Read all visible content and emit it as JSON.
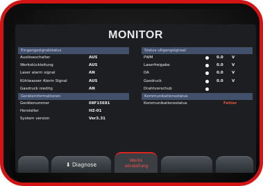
{
  "screen": {
    "title": "MONITOR"
  },
  "left": {
    "input_status": {
      "header": "Eingangssignalstatus",
      "rows": [
        {
          "label": "Auslöseschalter",
          "value": "AUS"
        },
        {
          "label": "Werkstückleitung",
          "value": "AUS"
        },
        {
          "label": "Laser alarm signal",
          "value": "AN"
        },
        {
          "label": "Kühlwasser Alarm Signal",
          "value": "AUS"
        },
        {
          "label": "Gasdruck niedrig",
          "value": "AN"
        }
      ]
    },
    "device_info": {
      "header": "Geräteinformationen",
      "rows": [
        {
          "label": "Gerätenummer",
          "value": "08F15E81"
        },
        {
          "label": "Hersteller",
          "value": "HZ-01"
        },
        {
          "label": "System version",
          "value": "Ver3.31"
        }
      ]
    }
  },
  "right": {
    "output_status": {
      "header": "Status ultgangsignaal",
      "rows": [
        {
          "label": "PWM",
          "value": "0.0",
          "unit": "V"
        },
        {
          "label": "Laserfreigabe",
          "value": "0.0",
          "unit": "V"
        },
        {
          "label": "DA",
          "value": "0.0",
          "unit": "V"
        },
        {
          "label": "Gasdruck",
          "value": "0.0",
          "unit": "V"
        },
        {
          "label": "Drahtvorschub"
        }
      ]
    },
    "comm_status": {
      "header": "Kommunikationsstatus",
      "rows": [
        {
          "label": "Kommunikationsstatus",
          "value": "Fehler"
        }
      ]
    }
  },
  "tabs": [
    {
      "label": ""
    },
    {
      "label": "Diagnose",
      "icon": "down-arrow-icon"
    },
    {
      "label_line1": "Werks",
      "label_line2": "-einstellung",
      "active": true
    },
    {
      "label": ""
    },
    {
      "label": ""
    }
  ],
  "colors": {
    "frame": "#d21414",
    "section_header": "#43506b",
    "error": "#e2553c",
    "active_tab": "#ff5050"
  }
}
